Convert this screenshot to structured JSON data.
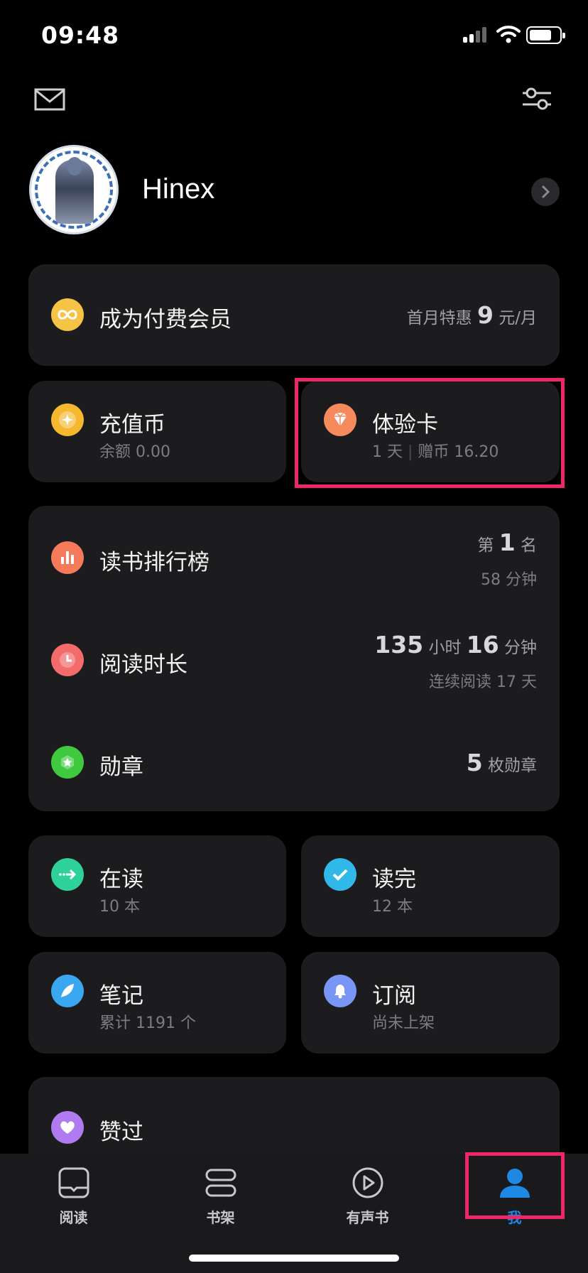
{
  "status_bar": {
    "time": "09:48"
  },
  "profile": {
    "name": "Hinex"
  },
  "membership": {
    "title": "成为付费会员",
    "offer_prefix": "首月特惠",
    "offer_price": "9",
    "offer_unit": "元/月"
  },
  "coins": {
    "title": "充值币",
    "sub": "余额 0.00"
  },
  "trial_card": {
    "title": "体验卡",
    "days": "1 天",
    "bonus": "赠币 16.20"
  },
  "stats": {
    "ranking": {
      "title": "读书排行榜",
      "rank_prefix": "第",
      "rank_value": "1",
      "rank_suffix": "名",
      "time": "58 分钟"
    },
    "duration": {
      "title": "阅读时长",
      "hours": "135",
      "hours_unit": "小时",
      "minutes": "16",
      "minutes_unit": "分钟",
      "streak": "连续阅读 17 天"
    },
    "badges": {
      "title": "勋章",
      "count": "5",
      "count_unit": "枚勋章"
    }
  },
  "reading": {
    "title": "在读",
    "sub": "10 本"
  },
  "finished": {
    "title": "读完",
    "sub": "12 本"
  },
  "notes": {
    "title": "笔记",
    "sub": "累计 1191 个"
  },
  "subscribe": {
    "title": "订阅",
    "sub": "尚未上架"
  },
  "liked": {
    "title": "赞过"
  },
  "tabs": [
    {
      "label": "阅读",
      "icon": "book-icon",
      "active": false
    },
    {
      "label": "书架",
      "icon": "shelf-icon",
      "active": false
    },
    {
      "label": "有声书",
      "icon": "play-icon",
      "active": false
    },
    {
      "label": "我",
      "icon": "person-icon",
      "active": true
    }
  ],
  "colors": {
    "card_bg": "#1c1c1e",
    "highlight": "#f0266b",
    "active_tab": "#1e88e5",
    "membership_icon": "#f5c445",
    "coin_icon": "#f5b82e",
    "trial_icon": "#f78a5c",
    "ranking_icon": "#f57a5a",
    "duration_icon": "#f36b6b",
    "badge_icon": "#3ec93e",
    "reading_icon": "#2fd19a",
    "finished_icon": "#2fb8e8",
    "notes_icon": "#3aa8f0",
    "subscribe_icon": "#7a96f5",
    "liked_icon": "#b07bf0"
  }
}
